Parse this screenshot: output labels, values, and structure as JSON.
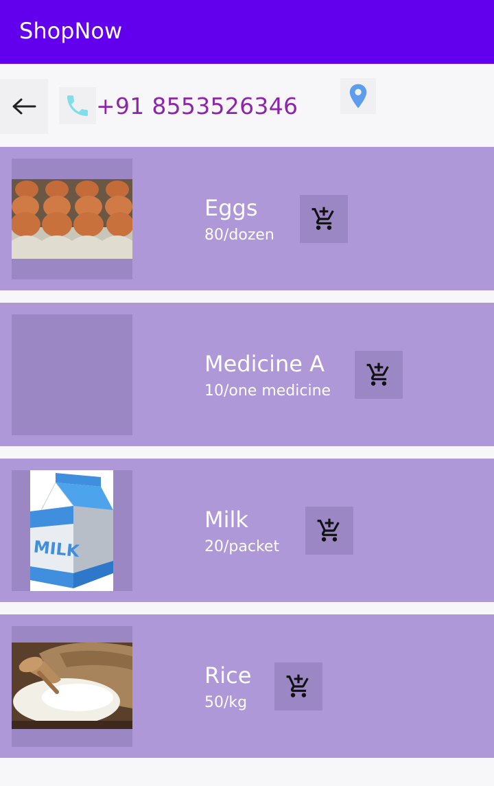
{
  "app": {
    "title": "ShopNow",
    "colors": {
      "app_bar": "#6200ee",
      "card_background": "#ae98d8",
      "phone_text": "#8e24aa",
      "phone_icon": "#80deea",
      "location_icon": "#5c9ded"
    }
  },
  "header": {
    "back_icon": "arrow-left-icon",
    "phone_icon": "phone-icon",
    "phone_number": "+91 8553526346",
    "location_icon": "map-pin-icon"
  },
  "products": [
    {
      "name": "Eggs",
      "price": "80/dozen",
      "image": "eggs-image",
      "cart_icon": "add-to-cart-icon"
    },
    {
      "name": "Medicine A",
      "price": "10/one medicine",
      "image": "empty-image-placeholder",
      "cart_icon": "add-to-cart-icon"
    },
    {
      "name": "Milk",
      "price": "20/packet",
      "image": "milk-carton-image",
      "cart_icon": "add-to-cart-icon"
    },
    {
      "name": "Rice",
      "price": "50/kg",
      "image": "rice-sack-image",
      "cart_icon": "add-to-cart-icon"
    }
  ]
}
